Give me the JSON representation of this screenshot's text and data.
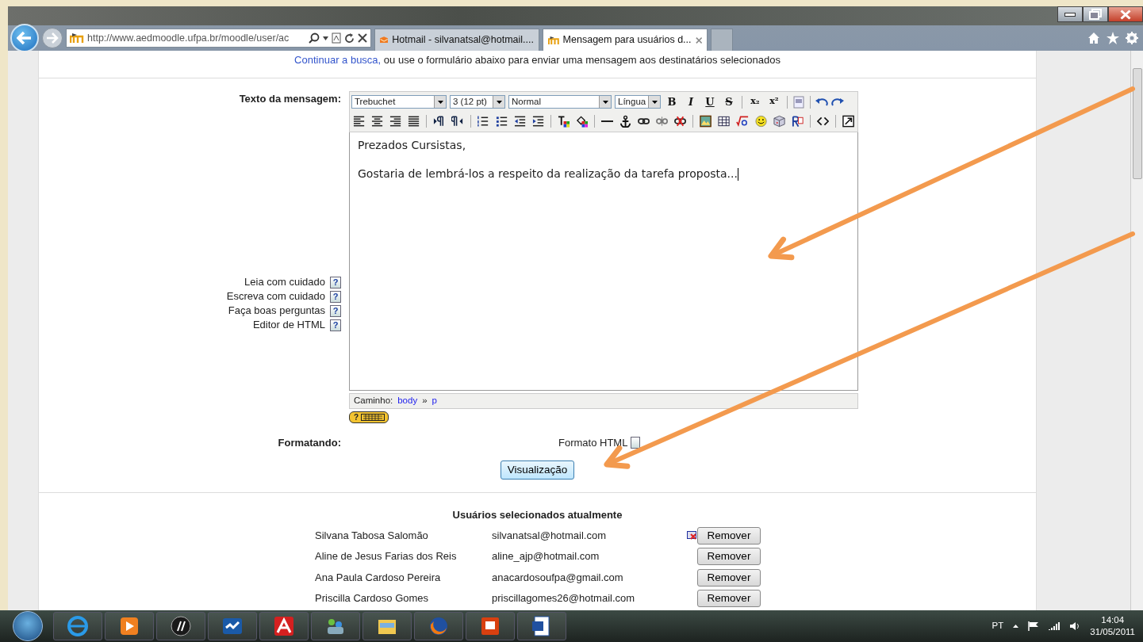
{
  "browser": {
    "address": "http://www.aedmoodle.ufpa.br/moodle/user/ac",
    "tabs": [
      {
        "title": "Hotmail - silvanatsal@hotmail....",
        "selected": false
      },
      {
        "title": "Mensagem para usuários d...",
        "selected": true
      }
    ]
  },
  "page": {
    "intro_link": "Continuar a busca,",
    "intro_text": "ou use o formulário abaixo para enviar uma mensagem aos destinatários selecionados",
    "message_label": "Texto da mensagem:",
    "help_links": [
      {
        "label": "Leia com cuidado",
        "icon": "?"
      },
      {
        "label": "Escreva com cuidado",
        "icon": "?"
      },
      {
        "label": "Faça boas perguntas",
        "icon": "?"
      },
      {
        "label": "Editor de HTML",
        "icon": "?"
      }
    ],
    "editor": {
      "selects": [
        "Trebuchet",
        "3 (12 pt)",
        "Normal",
        "Língua"
      ],
      "format_buttons": [
        "B",
        "I",
        "U",
        "S"
      ],
      "script_buttons": [
        "x₂",
        "x²"
      ],
      "paragraphs": [
        "Prezados Cursistas,",
        "Gostaria de lembrá-los a respeito da realização da tarefa proposta..."
      ],
      "path_label": "Caminho:",
      "path": [
        "body",
        "p"
      ],
      "path_separator": "»",
      "keyboard_help": "?"
    },
    "formatting_label": "Formatando:",
    "format_value": "Formato HTML",
    "preview_button": "Visualização",
    "selected_users": {
      "title": "Usuários selecionados atualmente",
      "rows": [
        {
          "name": "Silvana Tabosa Salomão",
          "email": "silvanatsal@hotmail.com",
          "flagged": true,
          "button": "Remover"
        },
        {
          "name": "Aline de Jesus Farias dos Reis",
          "email": "aline_ajp@hotmail.com",
          "flagged": false,
          "button": "Remover"
        },
        {
          "name": "Ana Paula Cardoso Pereira",
          "email": "anacardosoufpa@gmail.com",
          "flagged": false,
          "button": "Remover"
        },
        {
          "name": "Priscilla Cardoso Gomes",
          "email": "priscillagomes26@hotmail.com",
          "flagged": false,
          "button": "Remover"
        }
      ]
    }
  },
  "taskbar": {
    "language": "PT",
    "time": "14:04",
    "date": "31/05/2011"
  }
}
